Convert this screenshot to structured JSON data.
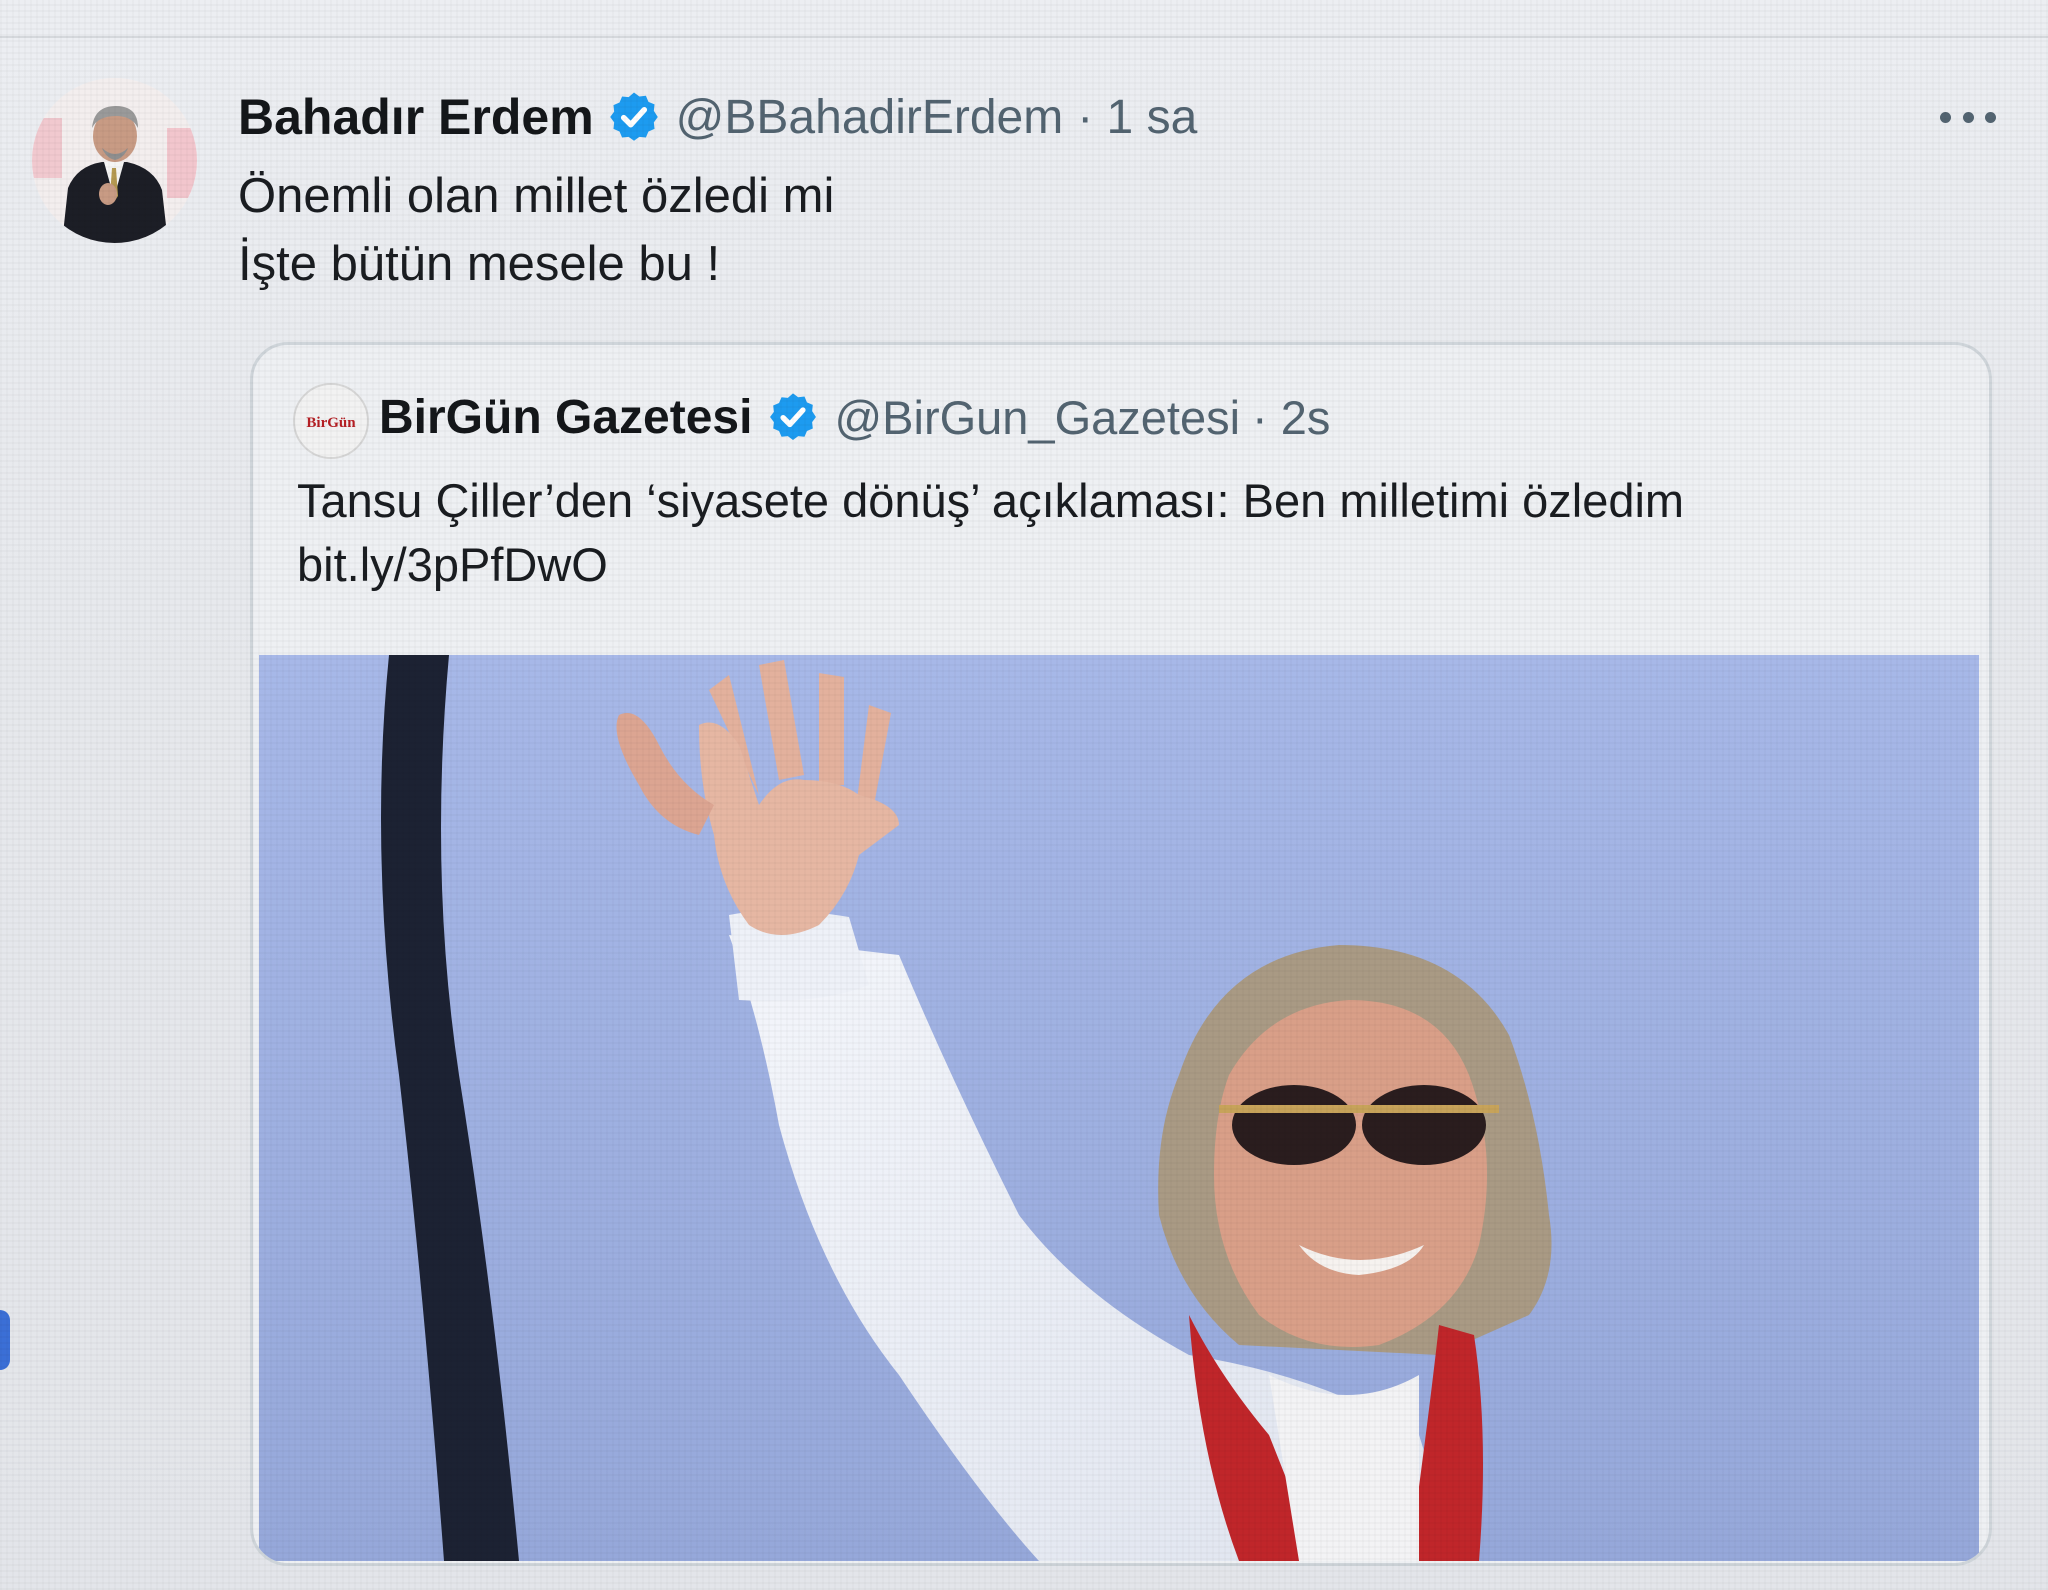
{
  "tweet": {
    "author": {
      "display_name": "Bahadır Erdem",
      "handle": "@BBahadirErdem",
      "time": "· 1 sa",
      "avatar_icon": "avatar-photo",
      "verified": true
    },
    "text_lines": [
      "Önemli olan millet özledi mi",
      "İşte bütün mesele bu !"
    ],
    "more_icon": "more-dots-icon"
  },
  "quoted_tweet": {
    "author": {
      "display_name": "BirGün Gazetesi",
      "handle": "@BirGun_Gazetesi",
      "time": "· 2s",
      "avatar_logo_text": "BirGün",
      "verified": true
    },
    "text_line": "Tansu Çiller’den ‘siyasete dönüş’ açıklaması: Ben milletimi özledim",
    "link": "bit.ly/3pPfDwO",
    "media": "photo-woman-waving"
  },
  "colors": {
    "verified_blue": "#1d9bf0",
    "muted_text": "#536471",
    "sky": "#a5b6e6"
  }
}
